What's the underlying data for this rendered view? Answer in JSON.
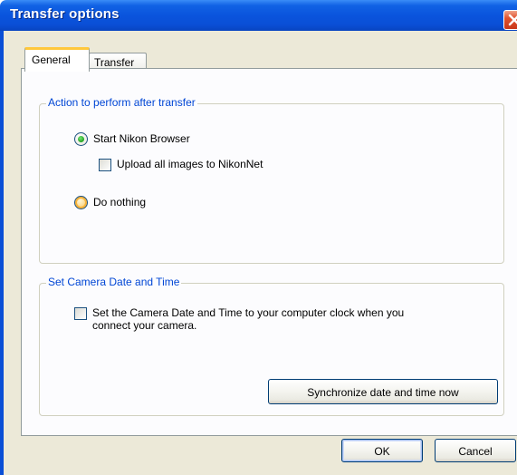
{
  "window": {
    "title": "Transfer options",
    "title_color": "#ffffff",
    "titlebar_color": "#0a54dd",
    "close_icon": "close-icon"
  },
  "tabs": [
    {
      "label": "General",
      "selected": true
    },
    {
      "label": "Transfer",
      "selected": false
    }
  ],
  "group_after_transfer": {
    "title": "Action to perform after transfer",
    "options": {
      "start_browser": {
        "label": "Start Nikon Browser",
        "checked": true
      },
      "upload_nikonnet": {
        "label": "Upload all images to NikonNet",
        "checked": false
      },
      "do_nothing": {
        "label": "Do nothing",
        "checked": false
      }
    }
  },
  "group_camera_time": {
    "title": "Set Camera Date and Time",
    "checkbox": {
      "line1": "Set the Camera Date and Time to your computer clock when you",
      "line2": "connect your camera.",
      "checked": false
    },
    "sync_button_label": "Synchronize date and time now"
  },
  "footer": {
    "ok_label": "OK",
    "cancel_label": "Cancel"
  },
  "colors": {
    "group_title": "#0046d5",
    "dialog_bg": "#ece9d8",
    "tab_accent": "#ffc83c"
  }
}
